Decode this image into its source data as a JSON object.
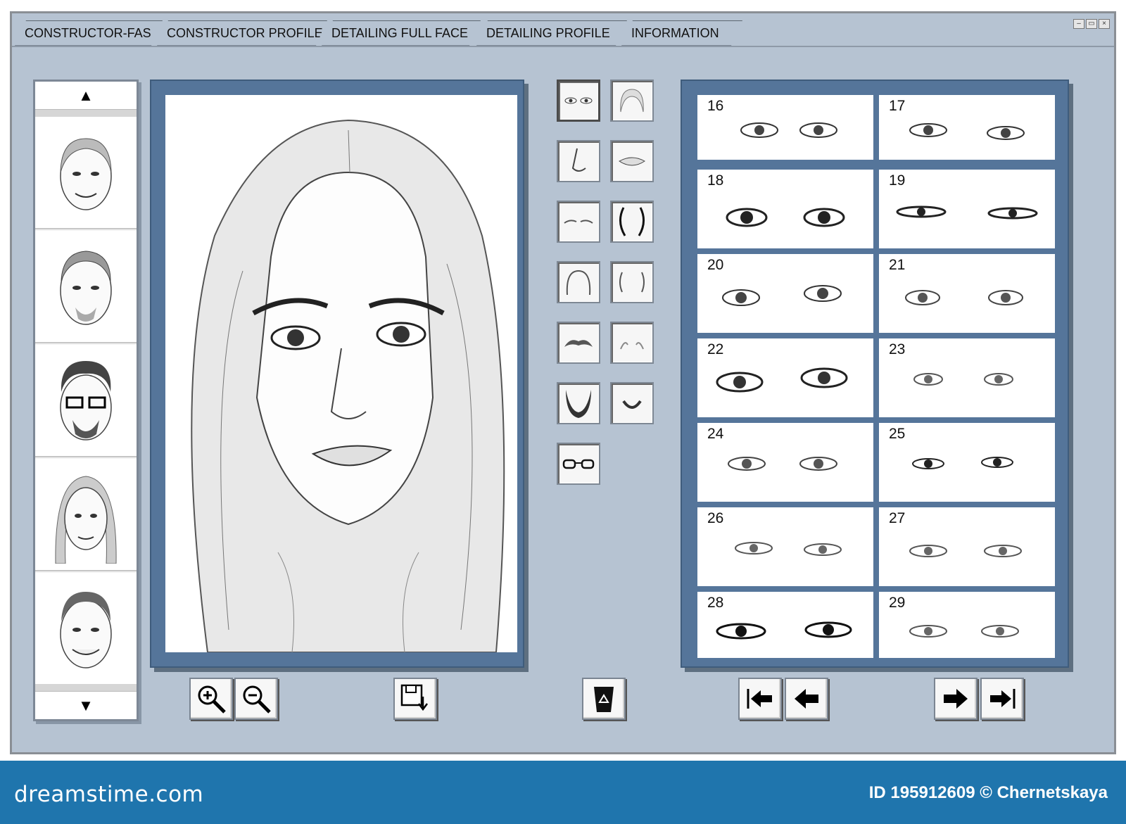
{
  "tabs": [
    {
      "label": "CONSTRUCTOR-FAS"
    },
    {
      "label": "CONSTRUCTOR PROFILE"
    },
    {
      "label": "DETAILING FULL FACE"
    },
    {
      "label": "DETAILING PROFILE"
    },
    {
      "label": "INFORMATION"
    }
  ],
  "window_controls": {
    "minimize": "–",
    "restore": "▭",
    "close": "×"
  },
  "strip": {
    "up_arrow": "▲",
    "down_arrow": "▼"
  },
  "catalog": {
    "numbers": [
      "16",
      "17",
      "18",
      "19",
      "20",
      "21",
      "22",
      "23",
      "24",
      "25",
      "26",
      "27",
      "28",
      "29"
    ]
  },
  "footer": {
    "brand": "dreamstime.com",
    "credit": "ID 195912609 © Chernetskaya"
  },
  "colors": {
    "window_bg": "#b6c3d2",
    "frame_blue": "#55759a",
    "footer_blue": "#1f75ad"
  }
}
